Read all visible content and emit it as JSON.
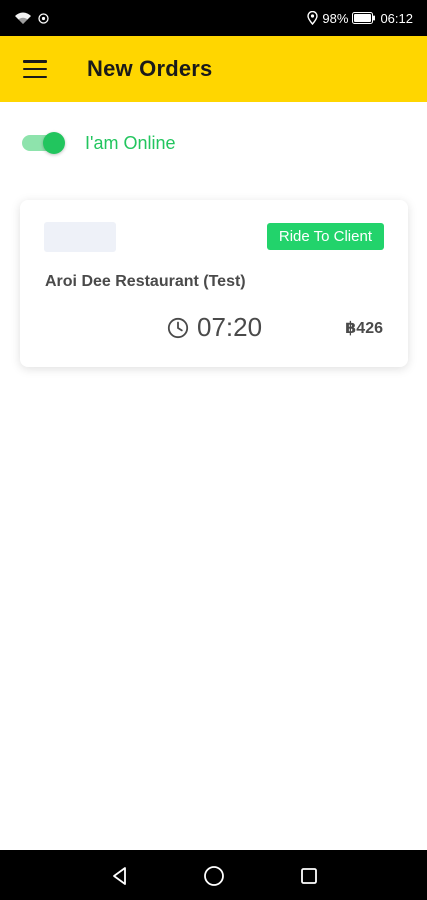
{
  "status_bar": {
    "battery": "98%",
    "time": "06:12",
    "icons": [
      "wifi-icon",
      "hotspot-icon",
      "location-icon",
      "battery-icon"
    ]
  },
  "app_bar": {
    "title": "New Orders",
    "menu_icon": "menu-icon",
    "background_color": "#FFD600"
  },
  "online_toggle": {
    "label": "I'am Online",
    "state": "on",
    "accent_color": "#22C55E"
  },
  "orders": [
    {
      "status": "Ride To Client",
      "restaurant": "Aroi Dee Restaurant (Test)",
      "time": "07:20",
      "price": "฿426",
      "status_color": "#22D36B"
    }
  ],
  "nav_bar": {
    "icons": [
      "back-icon",
      "home-icon",
      "recents-icon"
    ]
  }
}
